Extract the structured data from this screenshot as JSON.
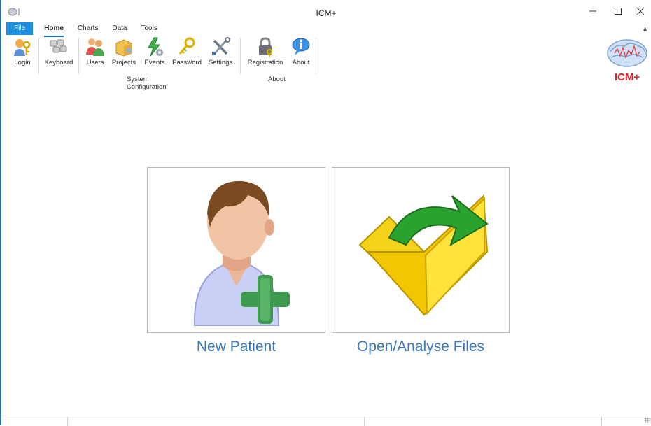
{
  "window": {
    "title": "ICM+"
  },
  "tabs": [
    {
      "label": "File"
    },
    {
      "label": "Home"
    },
    {
      "label": "Charts"
    },
    {
      "label": "Data"
    },
    {
      "label": "Tools"
    }
  ],
  "ribbon": {
    "buttons": [
      {
        "label": "Login",
        "icon": "login-key-icon"
      },
      {
        "label": "Keyboard",
        "icon": "keyboard-icon"
      },
      {
        "label": "Users",
        "icon": "users-icon"
      },
      {
        "label": "Projects",
        "icon": "projects-icon"
      },
      {
        "label": "Events",
        "icon": "events-icon"
      },
      {
        "label": "Password",
        "icon": "password-keys-icon"
      },
      {
        "label": "Settings",
        "icon": "settings-tools-icon"
      },
      {
        "label": "Registration",
        "icon": "registration-lock-icon"
      },
      {
        "label": "About",
        "icon": "about-info-icon"
      }
    ],
    "groups": [
      {
        "label": "System Configuration"
      },
      {
        "label": "About"
      }
    ]
  },
  "logo": {
    "text": "ICM+",
    "color": "#e8202a"
  },
  "tiles": [
    {
      "label": "New Patient",
      "icon": "new-patient-icon"
    },
    {
      "label": "Open/Analyse Files",
      "icon": "open-folder-icon"
    }
  ],
  "colors": {
    "accent": "#1e8fe0",
    "tile_label": "#3a78b8"
  }
}
